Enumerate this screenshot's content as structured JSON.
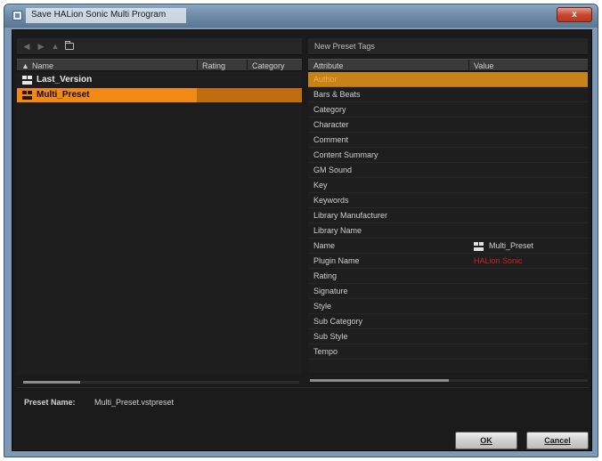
{
  "window": {
    "title": "Save HALion Sonic Multi Program",
    "close_label": "x"
  },
  "left_panel": {
    "columns": {
      "name": "Name",
      "rating": "Rating",
      "category": "Category"
    },
    "sort_indicator": "▲",
    "items": [
      {
        "name": "Last_Version",
        "selected": false
      },
      {
        "name": "Multi_Preset",
        "selected": true
      }
    ]
  },
  "right_panel": {
    "title": "New Preset Tags",
    "columns": {
      "attribute": "Attribute",
      "value": "Value"
    },
    "attributes": [
      {
        "name": "Author",
        "value": "",
        "selected": true
      },
      {
        "name": "Bars & Beats",
        "value": ""
      },
      {
        "name": "Category",
        "value": ""
      },
      {
        "name": "Character",
        "value": ""
      },
      {
        "name": "Comment",
        "value": ""
      },
      {
        "name": "Content Summary",
        "value": ""
      },
      {
        "name": "GM Sound",
        "value": ""
      },
      {
        "name": "Key",
        "value": ""
      },
      {
        "name": "Keywords",
        "value": ""
      },
      {
        "name": "Library Manufacturer",
        "value": ""
      },
      {
        "name": "Library Name",
        "value": ""
      },
      {
        "name": "Name",
        "value": "Multi_Preset",
        "icon": "multi-preset-icon"
      },
      {
        "name": "Plugin Name",
        "value": "HALion Sonic",
        "value_color": "#d0241c"
      },
      {
        "name": "Rating",
        "value": ""
      },
      {
        "name": "Signature",
        "value": ""
      },
      {
        "name": "Style",
        "value": ""
      },
      {
        "name": "Sub Category",
        "value": ""
      },
      {
        "name": "Sub Style",
        "value": ""
      },
      {
        "name": "Tempo",
        "value": ""
      }
    ]
  },
  "footer": {
    "preset_name_label": "Preset Name:",
    "preset_name_value": "Multi_Preset.vstpreset",
    "ok_label": "OK",
    "cancel_label": "Cancel"
  },
  "colors": {
    "selection": "#f08a14",
    "selected_attribute": "#c58318",
    "accent_red": "#d0241c"
  }
}
